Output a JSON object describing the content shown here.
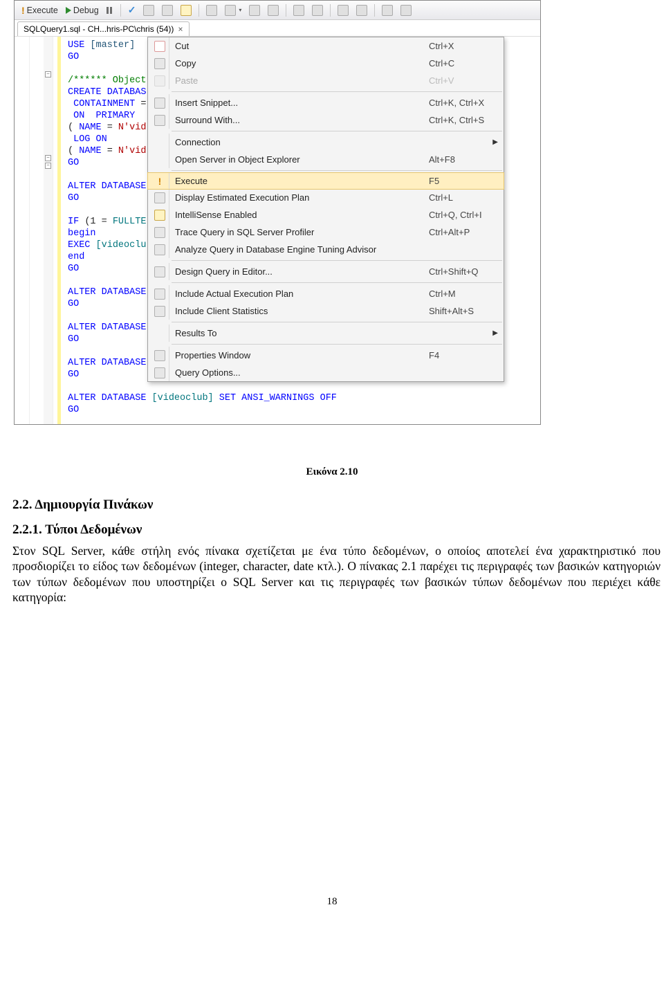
{
  "toolbar": {
    "execute": "Execute",
    "debug": "Debug"
  },
  "tab": {
    "title": "SQLQuery1.sql - CH...hris-PC\\chris (54))"
  },
  "code": {
    "l1a": "USE ",
    "l1b": "[master]",
    "l2": "GO",
    "l3a": "/****** Object",
    "l3comment": ":",
    "l4a": "CREATE",
    "l4b": " DATABAS",
    "l5a": " CONTAINMENT ",
    "l5b": "=",
    "l6a": " ON ",
    "l6b": " PRIMARY",
    "l7a": "( ",
    "l7b": "NAME ",
    "l7c": "=",
    "l7d": " N'vid",
    "l8a": " LOG",
    "l8b": " ON",
    "l9a": "( ",
    "l9b": "NAME ",
    "l9c": "=",
    "l9d": " N'vid",
    "l10": "GO",
    "l11a": "ALTER",
    "l11b": " DATABASE",
    "l12": "GO",
    "l13a": "IF ",
    "l13b": "(",
    "l13c": "1 ",
    "l13d": "=",
    "l13e": " FULLTE",
    "l14": "begin",
    "l15a": "EXEC ",
    "l15b": "[videoclu",
    "l16": "end",
    "l17": "GO",
    "l18a": "ALTER",
    "l18b": " DATABASE",
    "l19": "GO",
    "l20a": "ALTER",
    "l20b": " DATABASE",
    "l21": "GO",
    "l22a": "ALTER",
    "l22b": " DATABASE",
    "l23": "GO",
    "l24a": "ALTER",
    "l24b": " DATABASE ",
    "l24c": "[videoclub]",
    "l24d": " SET",
    "l24e": " ANSI_WARNINGS ",
    "l24f": "OFF",
    "l25": "GO"
  },
  "menu": {
    "cut": {
      "label": "Cut",
      "shortcut": "Ctrl+X"
    },
    "copy": {
      "label": "Copy",
      "shortcut": "Ctrl+C"
    },
    "paste": {
      "label": "Paste",
      "shortcut": "Ctrl+V"
    },
    "insert_snippet": {
      "label": "Insert Snippet...",
      "shortcut": "Ctrl+K, Ctrl+X"
    },
    "surround_with": {
      "label": "Surround With...",
      "shortcut": "Ctrl+K, Ctrl+S"
    },
    "connection": {
      "label": "Connection",
      "shortcut": ""
    },
    "open_server": {
      "label": "Open Server in Object Explorer",
      "shortcut": "Alt+F8"
    },
    "execute": {
      "label": "Execute",
      "shortcut": "F5"
    },
    "exec_plan": {
      "label": "Display Estimated Execution Plan",
      "shortcut": "Ctrl+L"
    },
    "intellisense": {
      "label": "IntelliSense Enabled",
      "shortcut": "Ctrl+Q, Ctrl+I"
    },
    "trace": {
      "label": "Trace Query in SQL Server Profiler",
      "shortcut": "Ctrl+Alt+P"
    },
    "analyze": {
      "label": "Analyze Query in Database Engine Tuning Advisor",
      "shortcut": ""
    },
    "design": {
      "label": "Design Query in Editor...",
      "shortcut": "Ctrl+Shift+Q"
    },
    "include_plan": {
      "label": "Include Actual Execution Plan",
      "shortcut": "Ctrl+M"
    },
    "include_stats": {
      "label": "Include Client Statistics",
      "shortcut": "Shift+Alt+S"
    },
    "results_to": {
      "label": "Results To",
      "shortcut": ""
    },
    "properties": {
      "label": "Properties Window",
      "shortcut": "F4"
    },
    "query_options": {
      "label": "Query Options...",
      "shortcut": ""
    }
  },
  "caption": "Εικόνα 2.10",
  "section_heading_1": "2.2. Δημιουργία Πινάκων",
  "section_heading_2": "2.2.1. Τύποι Δεδομένων",
  "paragraph": "Στον SQL Server, κάθε στήλη ενός πίνακα σχετίζεται με ένα τύπο δεδομένων, ο οποίος αποτελεί ένα χαρακτηριστικό που προσδιορίζει το είδος των δεδομένων (integer, character, date κτλ.). Ο πίνακας 2.1 παρέχει τις περιγραφές των βασικών κατηγοριών των τύπων δεδομένων που υποστηρίζει ο SQL Server και τις περιγραφές των βασικών τύπων δεδομένων που περιέχει κάθε κατηγορία:",
  "page_number": "18"
}
